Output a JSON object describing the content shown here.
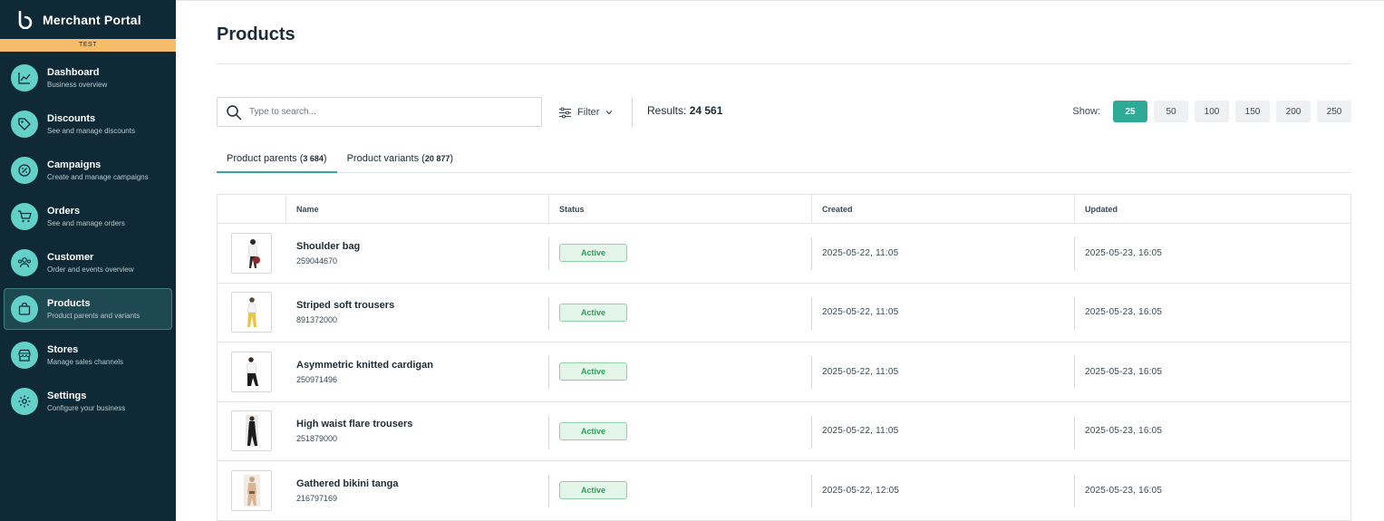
{
  "sidebar": {
    "brand": "Merchant Portal",
    "env": "TEST",
    "items": [
      {
        "label": "Dashboard",
        "sub": "Business overview",
        "icon": "chart-line-icon"
      },
      {
        "label": "Discounts",
        "sub": "See and manage discounts",
        "icon": "tag-icon"
      },
      {
        "label": "Campaigns",
        "sub": "Create and manage campaigns",
        "icon": "percent-badge-icon"
      },
      {
        "label": "Orders",
        "sub": "See and manage orders",
        "icon": "cart-icon"
      },
      {
        "label": "Customer",
        "sub": "Order and events overview",
        "icon": "users-icon"
      },
      {
        "label": "Products",
        "sub": "Product parents and variants",
        "icon": "shopping-bag-icon"
      },
      {
        "label": "Stores",
        "sub": "Manage sales channels",
        "icon": "store-icon"
      },
      {
        "label": "Settings",
        "sub": "Configure your business",
        "icon": "gear-icon"
      }
    ],
    "active_index": 5
  },
  "page": {
    "title": "Products"
  },
  "toolbar": {
    "search_placeholder": "Type to search...",
    "filter_label": "Filter",
    "results_label": "Results:",
    "results_count": "24 561",
    "show_label": "Show:",
    "page_sizes": [
      "25",
      "50",
      "100",
      "150",
      "200",
      "250"
    ],
    "active_page_size": "25"
  },
  "tabs": [
    {
      "label": "Product parents",
      "count": "3 684",
      "active": true
    },
    {
      "label": "Product variants",
      "count": "20 877",
      "active": false
    }
  ],
  "table": {
    "columns": [
      "",
      "Name",
      "Status",
      "Created",
      "Updated"
    ],
    "rows": [
      {
        "name": "Shoulder bag",
        "id": "259044670",
        "status": "Active",
        "created": "2025-05-22, 11:05",
        "updated": "2025-05-23, 16:05"
      },
      {
        "name": "Striped soft trousers",
        "id": "891372000",
        "status": "Active",
        "created": "2025-05-22, 11:05",
        "updated": "2025-05-23, 16:05"
      },
      {
        "name": "Asymmetric knitted cardigan",
        "id": "250971496",
        "status": "Active",
        "created": "2025-05-22, 11:05",
        "updated": "2025-05-23, 16:05"
      },
      {
        "name": "High waist flare trousers",
        "id": "251879000",
        "status": "Active",
        "created": "2025-05-22, 11:05",
        "updated": "2025-05-23, 16:05"
      },
      {
        "name": "Gathered bikini tanga",
        "id": "216797169",
        "status": "Active",
        "created": "2025-05-22, 12:05",
        "updated": "2025-05-23, 16:05"
      }
    ]
  },
  "colors": {
    "sidebar_bg": "#0f2a36",
    "accent": "#2faa96",
    "icon_bg": "#63d1c8",
    "env_banner": "#f7bc6a",
    "status_active": "#2f9e56"
  }
}
